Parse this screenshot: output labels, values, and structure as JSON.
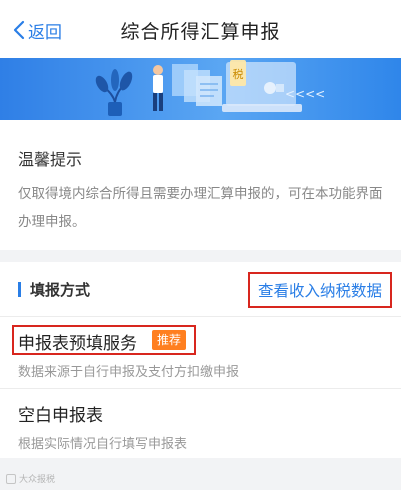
{
  "nav": {
    "back_label": "返回",
    "title": "综合所得汇算申报"
  },
  "banner": {
    "badge_glyph": "税",
    "arrows": "<<<<"
  },
  "notice": {
    "title": "温馨提示",
    "text": "仅取得境内综合所得且需要办理汇算申报的，可在本功能界面办理申报。"
  },
  "methods": {
    "section_title": "填报方式",
    "view_income_link": "查看收入纳税数据",
    "items": [
      {
        "title": "申报表预填服务",
        "badge": "推荐",
        "desc": "数据来源于自行申报及支付方扣缴申报"
      },
      {
        "title": "空白申报表",
        "desc": "根据实际情况自行填写申报表"
      }
    ]
  },
  "watermark": {
    "text": "大众报税"
  },
  "colors": {
    "accent": "#2a7ee6",
    "highlight_border": "#d8261e",
    "badge": "#ff7f1f",
    "background": "#f2f3f5"
  },
  "icons": {
    "back": "chevron-left-icon"
  }
}
